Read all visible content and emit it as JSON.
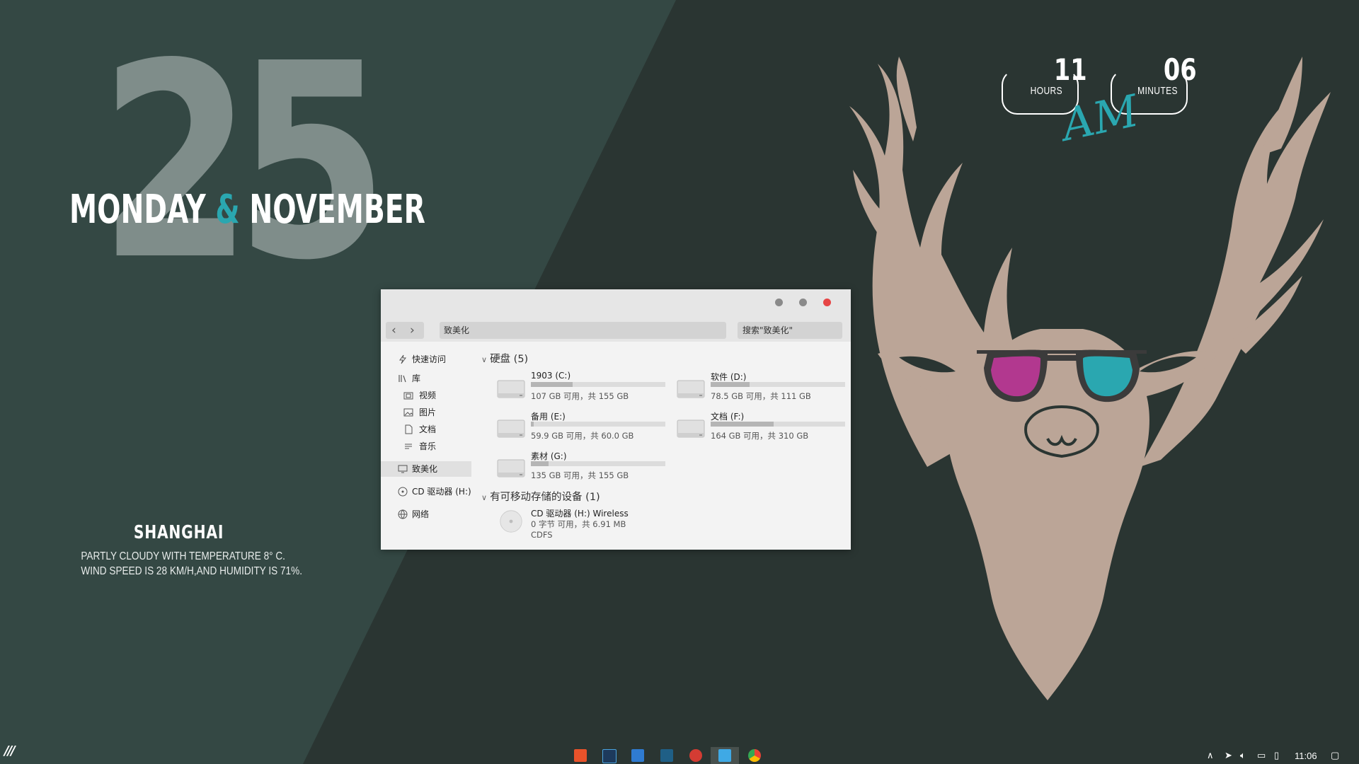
{
  "desktop": {
    "day_number": "25",
    "date_left": "MONDAY",
    "date_amp": "&",
    "date_right": "NOVEMBER",
    "weather_city": "SHANGHAI",
    "weather_line1": "PARTLY CLOUDY WITH TEMPERATURE 8° C.",
    "weather_line2": "WIND SPEED IS 28 KM/H,AND HUMIDITY IS 71%.",
    "clock_hours": "11",
    "clock_hours_label": "HOURS",
    "clock_minutes": "06",
    "clock_minutes_label": "MINUTES",
    "clock_ampm": "AM",
    "accent_color": "#2aa7b0"
  },
  "explorer": {
    "window_buttons": [
      "minimize",
      "maximize",
      "close"
    ],
    "address": "致美化",
    "search_placeholder": "搜索\"致美化\"",
    "sidebar": {
      "quick_access": "快速访问",
      "library": "库",
      "videos": "视频",
      "pictures": "图片",
      "documents": "文档",
      "music": "音乐",
      "this_pc": "致美化",
      "cd_drive": "CD 驱动器 (H:)",
      "network": "网络"
    },
    "group_disks": "硬盘 (5)",
    "drives": [
      {
        "name": "1903 (C:)",
        "info": "107 GB 可用，共 155 GB",
        "used_fraction": 0.31
      },
      {
        "name": "软件 (D:)",
        "info": "78.5 GB 可用，共 111 GB",
        "used_fraction": 0.29
      },
      {
        "name": "备用 (E:)",
        "info": "59.9 GB 可用，共 60.0 GB",
        "used_fraction": 0.02
      },
      {
        "name": "文档 (F:)",
        "info": "164 GB 可用，共 310 GB",
        "used_fraction": 0.47
      },
      {
        "name": "素材 (G:)",
        "info": "135 GB 可用，共 155 GB",
        "used_fraction": 0.13
      }
    ],
    "group_removable": "有可移动存储的设备 (1)",
    "cd": {
      "name": "CD 驱动器 (H:) Wireless",
      "info": "0 字节 可用，共 6.91 MB",
      "fs": "CDFS"
    }
  },
  "taskbar": {
    "start_glyph": "///",
    "apps": [
      "office-icon",
      "photoshop-icon",
      "notepad-icon",
      "terminal-icon",
      "netease-music-icon",
      "file-explorer-icon",
      "chrome-icon"
    ],
    "tray_time": "11:06"
  }
}
